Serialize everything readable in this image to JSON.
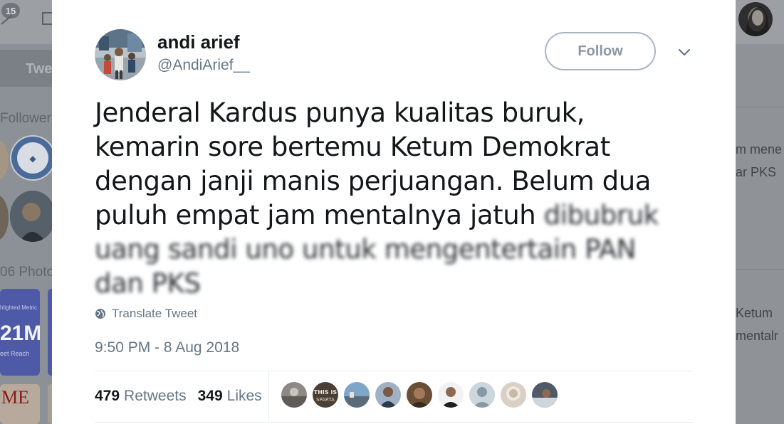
{
  "background": {
    "notification_count": "15",
    "tweet_button_label": "Twe",
    "followers_label": "Follower",
    "photos_label": "06 Photo",
    "card1_title": "hlighted Metric",
    "card1_value": "21M",
    "card1_sub": "eet Reach",
    "card2_text": "ME",
    "right_snippets": [
      "m mene",
      "ar PKS",
      "Ketum",
      "mentalr"
    ]
  },
  "tweet": {
    "author_name": "andi arief",
    "author_handle": "@AndiArief__",
    "follow_label": "Follow",
    "text_clear": "Jenderal Kardus punya kualitas buruk, kemarin sore bertemu Ketum Demokrat dengan janji manis perjuangan. Belum dua puluh empat jam mentalnya jatuh ",
    "text_blurred": "dibubruk uang sandi uno untuk mengentertain PAN dan PKS",
    "translate_label": "Translate Tweet",
    "timestamp": "9:50 PM - 8 Aug 2018",
    "retweets_count": "479",
    "retweets_label": "Retweets",
    "likes_count": "349",
    "likes_label": "Likes",
    "liker_avatars": [
      "liker-1",
      "liker-2",
      "liker-3",
      "liker-4",
      "liker-5",
      "liker-6",
      "liker-7",
      "liker-8",
      "liker-9"
    ]
  },
  "colors": {
    "text_primary": "#14171a",
    "text_secondary": "#657786",
    "follow_border": "#a9b6c2",
    "divider": "#e6ecf0",
    "overlay": "#8f949a"
  },
  "icons": [
    "globe-icon",
    "chevron-down-icon"
  ]
}
